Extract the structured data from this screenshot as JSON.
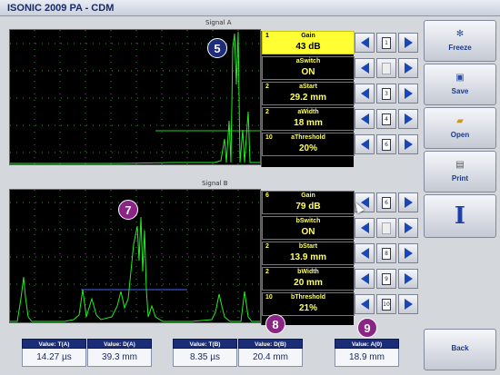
{
  "window": {
    "title": "ISONIC 2009 PA - CDM"
  },
  "signal_a": {
    "caption": "Signal A",
    "marker": "5",
    "params": [
      {
        "num": "1",
        "name": "Gain",
        "value": "43 dB",
        "active": true
      },
      {
        "num": "",
        "name": "aSwitch",
        "value": "ON",
        "active": false
      },
      {
        "num": "2",
        "name": "aStart",
        "value": "29.2 mm",
        "active": false
      },
      {
        "num": "2",
        "name": "aWidth",
        "value": "18 mm",
        "active": false
      },
      {
        "num": "10",
        "name": "aThreshold",
        "value": "20%",
        "active": false
      }
    ],
    "step_icons": [
      "1",
      "",
      "3",
      "4",
      "6"
    ]
  },
  "signal_b": {
    "caption": "Signal B",
    "marker": "7",
    "params": [
      {
        "num": "6",
        "name": "Gain",
        "value": "79 dB",
        "active": false
      },
      {
        "num": "",
        "name": "bSwitch",
        "value": "ON",
        "active": false
      },
      {
        "num": "2",
        "name": "bStart",
        "value": "13.9 mm",
        "active": false
      },
      {
        "num": "2",
        "name": "bWidth",
        "value": "20 mm",
        "active": false
      },
      {
        "num": "10",
        "name": "bThreshold",
        "value": "21%",
        "active": false
      }
    ],
    "step_icons": [
      "6",
      "",
      "8",
      "9",
      "10"
    ]
  },
  "sidebar": {
    "freeze": "Freeze",
    "save": "Save",
    "open": "Open",
    "print": "Print",
    "cursor": "I",
    "back": "Back"
  },
  "readouts": {
    "group1": [
      {
        "label": "Value: T(A)",
        "value": "14.27 µs"
      },
      {
        "label": "Value: D(A)",
        "value": "39.3 mm"
      }
    ],
    "group2": [
      {
        "label": "Value: T(B)",
        "value": "8.35 µs"
      },
      {
        "label": "Value: D(B)",
        "value": "20.4 mm"
      }
    ],
    "group3": [
      {
        "label": "Value: A(0)",
        "value": "18.9 mm"
      }
    ],
    "marker_8": "8",
    "marker_9": "9"
  },
  "colors": {
    "trace": "#22dd22",
    "gate": "#4466ff",
    "grid": "#33aa33",
    "header": "#1c2d78",
    "active_param": "#ffff33"
  }
}
